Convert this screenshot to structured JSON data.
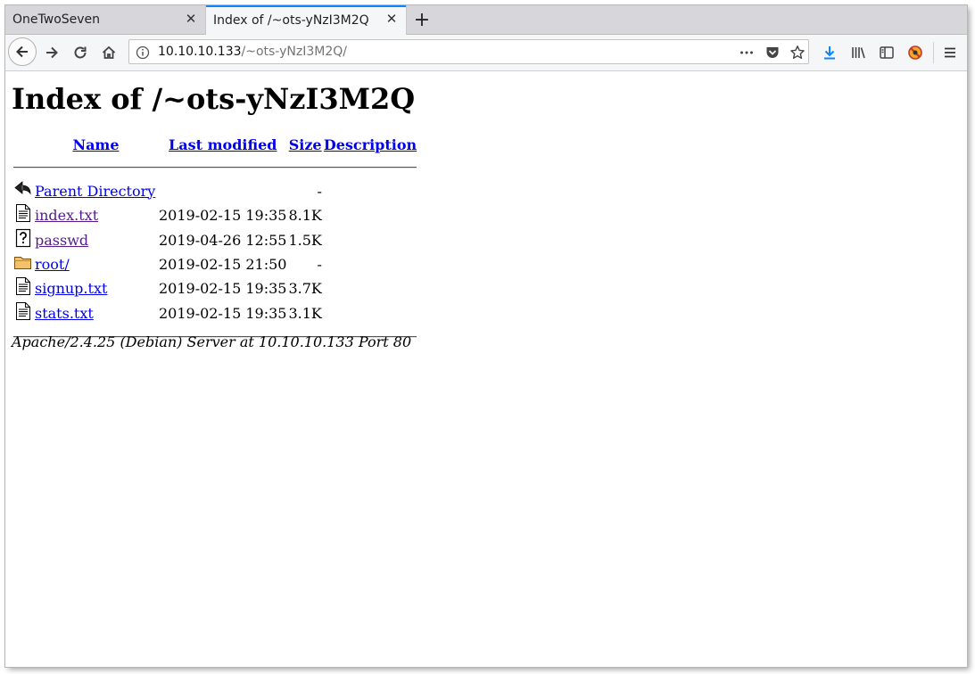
{
  "browser": {
    "tabs": [
      {
        "title": "OneTwoSeven",
        "active": false
      },
      {
        "title": "Index of /~ots-yNzI3M2Q",
        "active": true
      }
    ],
    "new_tab_symbol": "+",
    "url": {
      "host": "10.10.10.133",
      "path": "/~ots-yNzI3M2Q/"
    },
    "icons": [
      "back-icon",
      "forward-icon",
      "reload-icon",
      "home-icon",
      "info-icon",
      "more-icon",
      "pocket-icon",
      "bookmark-star-icon",
      "download-icon",
      "library-icon",
      "sidebar-icon",
      "addon-icon",
      "menu-icon"
    ],
    "accent_color": "#0a84ff"
  },
  "page": {
    "heading": "Index of /~ots-yNzI3M2Q",
    "columns": {
      "name": "Name",
      "modified": "Last modified",
      "size": "Size",
      "description": "Description"
    },
    "rows": [
      {
        "icon": "back-icon",
        "name": "Parent Directory",
        "modified": "",
        "size": "-",
        "visited": false
      },
      {
        "icon": "text-file-icon",
        "name": "index.txt",
        "modified": "2019-02-15 19:35",
        "size": "8.1K",
        "visited": true
      },
      {
        "icon": "unknown-file-icon",
        "name": "passwd",
        "modified": "2019-04-26 12:55",
        "size": "1.5K",
        "visited": true
      },
      {
        "icon": "folder-icon",
        "name": "root/",
        "modified": "2019-02-15 21:50",
        "size": "-",
        "visited": false
      },
      {
        "icon": "text-file-icon",
        "name": "signup.txt",
        "modified": "2019-02-15 19:35",
        "size": "3.7K",
        "visited": false
      },
      {
        "icon": "text-file-icon",
        "name": "stats.txt",
        "modified": "2019-02-15 19:35",
        "size": "3.1K",
        "visited": false
      }
    ],
    "footer": "Apache/2.4.25 (Debian) Server at 10.10.10.133 Port 80",
    "link_color": "#0000ee",
    "visited_color": "#551a8b"
  }
}
